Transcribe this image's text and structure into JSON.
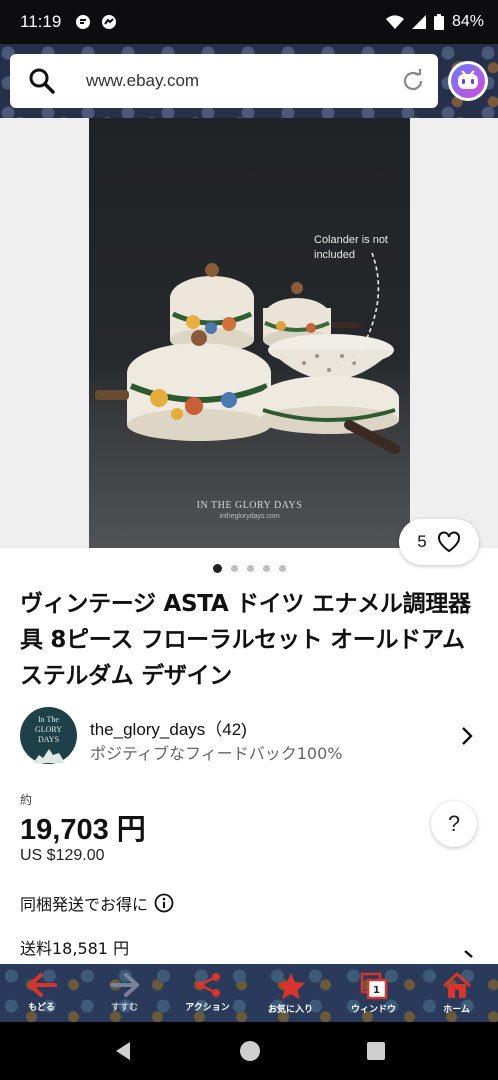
{
  "status_bar": {
    "time": "11:19",
    "battery": "84%"
  },
  "browser": {
    "url": "www.ebay.com"
  },
  "gallery": {
    "note": "Colander  is not included",
    "brand": "IN THE GLORY DAYS",
    "brand_url": "intheglorydays.com",
    "like_count": "5",
    "image_count": 5,
    "active_image": 1
  },
  "listing": {
    "title": "ヴィンテージ ASTA ドイツ エナメル調理器具 8ピース フローラルセット オールドアムステルダム デザイン",
    "seller_name": "the_glory_days（42)",
    "seller_feedback": "ポジティブなフィードバック100%",
    "seller_avatar_text": "In The GLORY DAYS",
    "approx_label": "約",
    "price": "19,703 円",
    "price_usd": "US $129.00",
    "combined_shipping": "同梱発送でお得に",
    "shipping": "送料18,581 円"
  },
  "toolbar": {
    "back": "もどる",
    "forward": "すすむ",
    "action": "アクション",
    "favorites": "お気に入り",
    "window": "ウィンドウ",
    "window_count": "1",
    "home": "ホーム"
  },
  "help_label": "?"
}
